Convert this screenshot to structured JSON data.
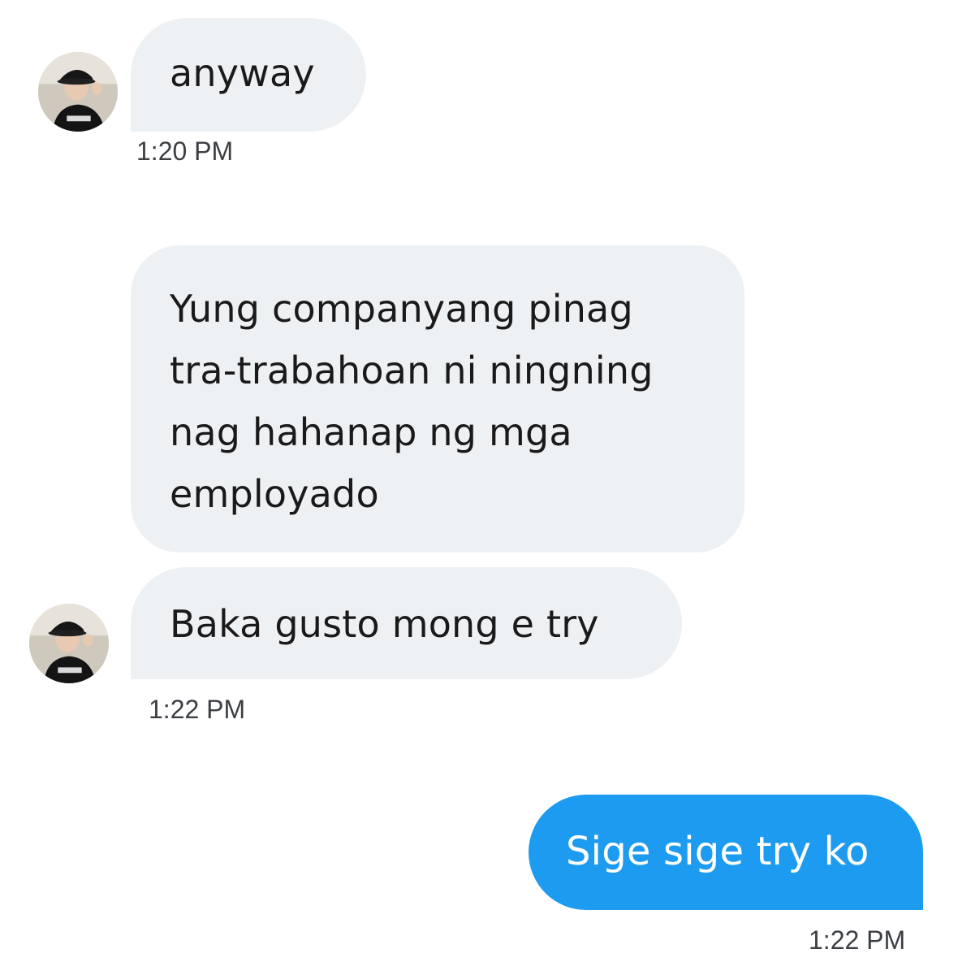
{
  "conversation": {
    "messages": [
      {
        "direction": "incoming",
        "text": "anyway",
        "timestamp": "1:20 PM"
      },
      {
        "direction": "incoming",
        "text": "Yung companyang pinag tra-trabahoan ni ningning nag hahanap ng mga employado"
      },
      {
        "direction": "incoming",
        "text": "Baka gusto mong e try",
        "timestamp": "1:22 PM"
      },
      {
        "direction": "outgoing",
        "text": "Sige sige try ko",
        "timestamp": "1:22 PM"
      }
    ]
  },
  "colors": {
    "incoming_bubble": "#eef1f3",
    "outgoing_bubble": "#1d9bf0",
    "timestamp_text": "#3b3f44"
  }
}
